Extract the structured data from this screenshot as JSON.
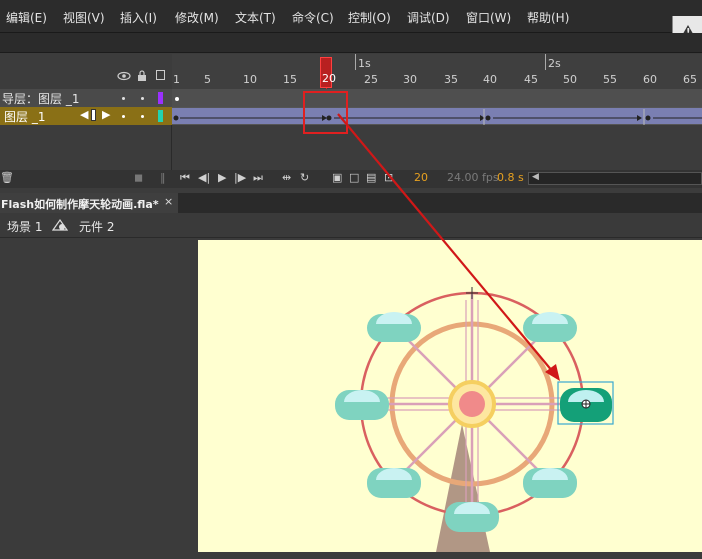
{
  "menu": {
    "items": [
      "编辑(E)",
      "视图(V)",
      "插入(I)",
      "修改(M)",
      "文本(T)",
      "命令(C)",
      "控制(O)",
      "调试(D)",
      "窗口(W)",
      "帮助(H)"
    ]
  },
  "warning": {
    "icon": "warning-icon"
  },
  "timeline": {
    "seconds_marks": [
      "1s",
      "2s"
    ],
    "frame_numbers": [
      "1",
      "5",
      "10",
      "15",
      "20",
      "25",
      "30",
      "35",
      "40",
      "45",
      "50",
      "55",
      "60",
      "65"
    ],
    "current_frame_label": "20",
    "layers": [
      {
        "name": "导层：图层 _1",
        "color": "#9b30ff"
      },
      {
        "name": "图层 _1",
        "color": "#22d3b0"
      }
    ],
    "status": {
      "current_frame": "20",
      "fps": "24.00 fps",
      "time": "0.8 s"
    }
  },
  "document": {
    "tab_title": "Flash如何制作摩天轮动画.fla*",
    "close_glyph": "×"
  },
  "edit_bar": {
    "scene": "场景 1",
    "symbol": "元件 2"
  },
  "colors": {
    "stage_bg": "#ffffd0",
    "highlight": "#e02020",
    "selected_layer": "#8a7016"
  }
}
